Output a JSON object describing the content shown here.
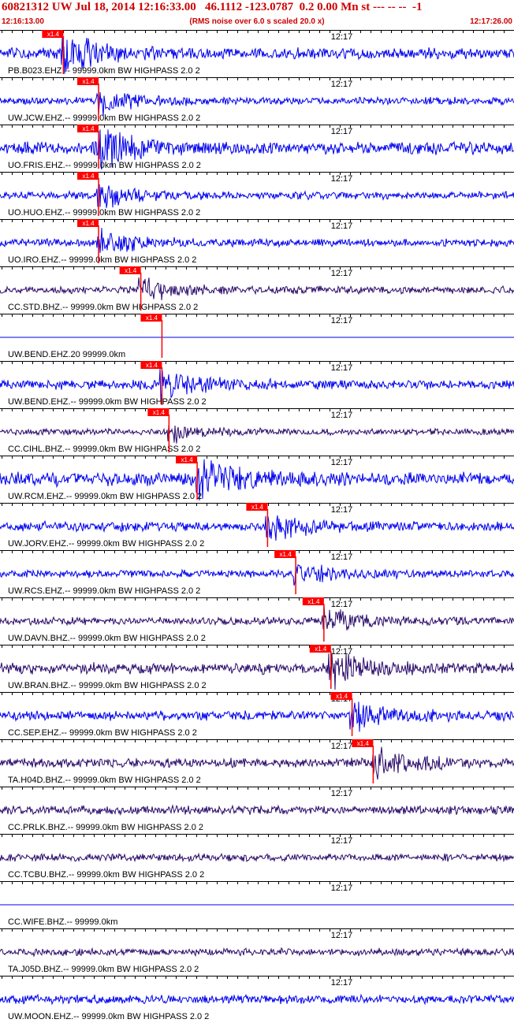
{
  "header": {
    "title": "60821312 UW Jul 18, 2014 12:16:33.00   46.1112 -123.0787  0.2 0.00 Mn st --- -- --  -1",
    "start_time": "12:16:13.00",
    "scale_note": "(RMS noise over 6.0 s scaled 20.0 x)",
    "end_time": "12:17:26.00"
  },
  "colors": {
    "header_text": "#cc0000",
    "pick_marker": "#ff0000",
    "trace_blue": "#0000ee",
    "trace_dark": "#2a0a6a"
  },
  "chart_data": {
    "type": "seismogram",
    "x_range": [
      "12:16:13.00",
      "12:17:26.00"
    ],
    "time_mark": "12:17",
    "pick_label": "x1.4",
    "traces": [
      {
        "label": "PB.B023.EHZ.-- 99999.0km BW HIGHPASS  2.0  2",
        "color": "blue",
        "pick": "12:16:22",
        "amp": 0.18
      },
      {
        "label": "UW.JCW.EHZ.-- 99999.0km BW HIGHPASS  2.0  2",
        "color": "blue",
        "pick": "12:16:27",
        "amp": 0.12
      },
      {
        "label": "UO.FRIS.EHZ.-- 99999.0km BW HIGHPASS  2.0  2",
        "color": "blue",
        "pick": "12:16:27",
        "amp": 0.2
      },
      {
        "label": "UO.HUO.EHZ.-- 99999.0km BW HIGHPASS  2.0  2",
        "color": "blue",
        "pick": "12:16:27",
        "amp": 0.12
      },
      {
        "label": "UO.IRO.EHZ.-- 99999.0km BW HIGHPASS  2.0  2",
        "color": "blue",
        "pick": "12:16:27",
        "amp": 0.12
      },
      {
        "label": "CC.STD.BHZ.-- 99999.0km BW HIGHPASS  2.0  2",
        "color": "dark",
        "pick": "12:16:33",
        "amp": 0.12
      },
      {
        "label": "UW.BEND.EHZ.20 99999.0km",
        "color": "flat",
        "pick": "12:16:36",
        "amp": 0
      },
      {
        "label": "UW.BEND.EHZ.-- 99999.0km BW HIGHPASS  2.0  2",
        "color": "blue",
        "pick": "12:16:36",
        "amp": 0.15
      },
      {
        "label": "CC.CIHL.BHZ.-- 99999.0km BW HIGHPASS  2.0  2",
        "color": "dark",
        "pick": "12:16:37",
        "amp": 0.1
      },
      {
        "label": "UW.RCM.EHZ.-- 99999.0km BW HIGHPASS  2.0  2",
        "color": "blue",
        "pick": "12:16:41",
        "amp": 0.22
      },
      {
        "label": "UW.JORV.EHZ.-- 99999.0km BW HIGHPASS  2.0  2",
        "color": "blue",
        "pick": "12:16:51",
        "amp": 0.15
      },
      {
        "label": "UW.RCS.EHZ.-- 99999.0km BW HIGHPASS  2.0  2",
        "color": "blue",
        "pick": "12:16:55",
        "amp": 0.12
      },
      {
        "label": "UW.DAVN.BHZ.-- 99999.0km BW HIGHPASS  2.0  2",
        "color": "dark",
        "pick": "12:16:59",
        "amp": 0.12
      },
      {
        "label": "UW.BRAN.BHZ.-- 99999.0km BW HIGHPASS  2.0  2",
        "color": "dark",
        "pick": "12:17:00",
        "amp": 0.18
      },
      {
        "label": "CC.SEP.EHZ.-- 99999.0km BW HIGHPASS  2.0  2",
        "color": "blue",
        "pick": "12:17:03",
        "amp": 0.15
      },
      {
        "label": "TA.H04D.BHZ.-- 99999.0km BW HIGHPASS  2.0  2",
        "color": "dark",
        "pick": "12:17:06",
        "amp": 0.15
      },
      {
        "label": "CC.PRLK.BHZ.-- 99999.0km BW HIGHPASS  2.0  2",
        "color": "dark",
        "pick": null,
        "amp": 0.14
      },
      {
        "label": "CC.TCBU.BHZ.-- 99999.0km BW HIGHPASS  2.0  2",
        "color": "dark",
        "pick": null,
        "amp": 0.12
      },
      {
        "label": "CC.WIFE.BHZ.-- 99999.0km",
        "color": "flat",
        "pick": null,
        "amp": 0
      },
      {
        "label": "TA.J05D.BHZ.-- 99999.0km BW HIGHPASS  2.0  2",
        "color": "dark",
        "pick": null,
        "amp": 0.12
      },
      {
        "label": "UW.MOON.EHZ.-- 99999.0km BW HIGHPASS  2.0  2",
        "color": "blue",
        "pick": null,
        "amp": 0.14
      }
    ]
  }
}
